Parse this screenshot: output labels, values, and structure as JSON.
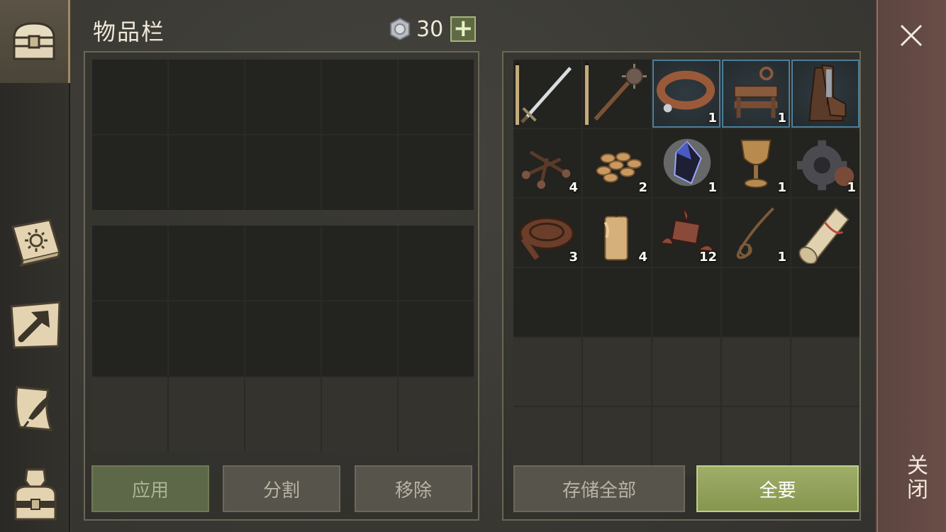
{
  "inventory": {
    "title": "物品栏",
    "currency": {
      "icon": "silver-coin-icon",
      "value": "30",
      "add_label": "+"
    },
    "buttons": {
      "use": "应用",
      "split": "分割",
      "remove": "移除"
    }
  },
  "storage": {
    "items": [
      {
        "name": "sword-icon",
        "qty": "",
        "wear": 0.95
      },
      {
        "name": "mace-icon",
        "qty": "",
        "wear": 0.95
      },
      {
        "name": "leather-collar-icon",
        "qty": "1",
        "highlight": true
      },
      {
        "name": "stocks-icon",
        "qty": "1",
        "highlight": true
      },
      {
        "name": "boots-icon",
        "qty": "",
        "highlight": true
      },
      {
        "name": "nails-icon",
        "qty": "4"
      },
      {
        "name": "seeds-icon",
        "qty": "2"
      },
      {
        "name": "dark-crystal-icon",
        "qty": "1"
      },
      {
        "name": "goblet-icon",
        "qty": "1"
      },
      {
        "name": "gear-icon",
        "qty": "1"
      },
      {
        "name": "leather-roll-icon",
        "qty": "3"
      },
      {
        "name": "candle-icon",
        "qty": "4"
      },
      {
        "name": "meat-scraps-icon",
        "qty": "12"
      },
      {
        "name": "rope-icon",
        "qty": "1"
      },
      {
        "name": "scroll-icon",
        "qty": ""
      }
    ],
    "buttons": {
      "store_all": "存储全部",
      "take_all": "全要"
    }
  },
  "close": {
    "label": "关闭",
    "icon": "close-icon"
  },
  "sidebar": {
    "items": [
      {
        "name": "chest-icon",
        "active": true
      },
      {
        "name": "sun-book-icon"
      },
      {
        "name": "hammer-map-icon"
      },
      {
        "name": "quill-scroll-icon"
      },
      {
        "name": "character-icon"
      }
    ]
  },
  "colors": {
    "accent_green": "#9eae68",
    "highlight_blue": "#4b7f9a",
    "close_red": "#6a4d47"
  }
}
